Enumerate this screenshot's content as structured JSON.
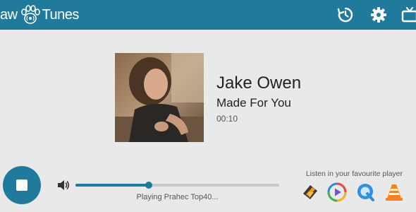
{
  "header": {
    "logo_prefix": "aw",
    "logo_suffix": "Tunes",
    "icons": [
      "history-icon",
      "settings-icon",
      "tv-icon"
    ]
  },
  "now_playing": {
    "artist": "Jake Owen",
    "title": "Made For You",
    "elapsed": "00:10"
  },
  "player": {
    "state": "playing",
    "volume_fraction": 0.36,
    "status": "Playing Prahec Top40..."
  },
  "external_players": {
    "label": "Listen in your favourite player",
    "players": [
      "winamp-icon",
      "windows-media-player-icon",
      "quicktime-icon",
      "vlc-icon"
    ]
  },
  "colors": {
    "accent": "#1f7a9c",
    "background": "#e9e9e9"
  }
}
